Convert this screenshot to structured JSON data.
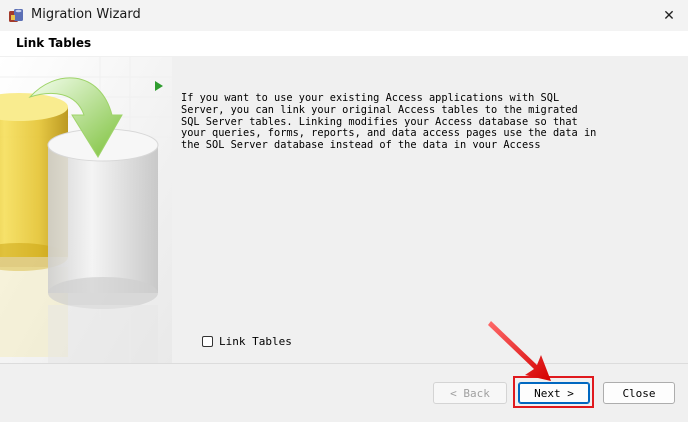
{
  "window": {
    "title": "Migration Wizard",
    "close_glyph": "✕"
  },
  "header": {
    "title": "Link Tables"
  },
  "content": {
    "description": "If you want to use your existing Access applications with SQL Server, you can link your original Access tables to the migrated SQL Server tables. Linking modifies your Access database so that your queries, forms, reports, and data access pages use the data in the SQL Server database instead of the data in your Access database."
  },
  "options": {
    "link_tables_label": "Link Tables",
    "link_tables_checked": false
  },
  "buttons": {
    "back": "< Back",
    "next": "Next >",
    "close": "Close"
  },
  "colors": {
    "accent": "#0067c0",
    "highlight": "#e0191d",
    "play": "#2e9c2e"
  },
  "icons": {
    "app": "migration-wizard-icon",
    "play": "play-arrow-icon",
    "close": "close-icon"
  }
}
